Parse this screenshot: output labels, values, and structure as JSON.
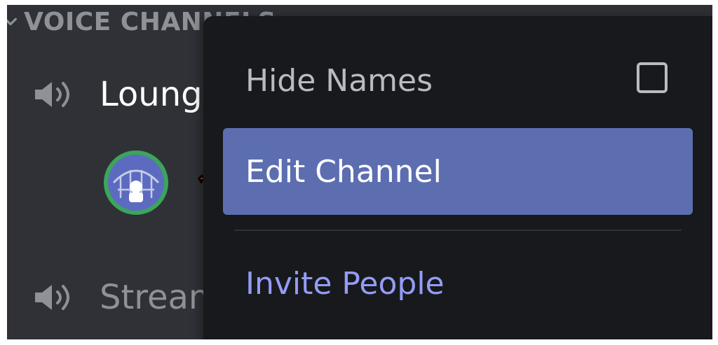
{
  "sidebar": {
    "section_header": "VOICE CHANNELS",
    "channels": [
      {
        "name": "Lounge",
        "icon": "speaker-icon"
      },
      {
        "name": "Stream",
        "icon": "speaker-icon"
      }
    ]
  },
  "context_menu": {
    "items": [
      {
        "label": "Hide Names",
        "control": "checkbox",
        "checked": false
      },
      {
        "label": "Edit Channel",
        "highlighted": true
      },
      {
        "label": "Invite People"
      }
    ]
  },
  "colors": {
    "sidebar_bg": "#2f3136",
    "menu_bg": "#18191c",
    "highlight": "#5c6eb0",
    "invite_accent": "#949cf7",
    "online_ring": "#3ba55c"
  }
}
